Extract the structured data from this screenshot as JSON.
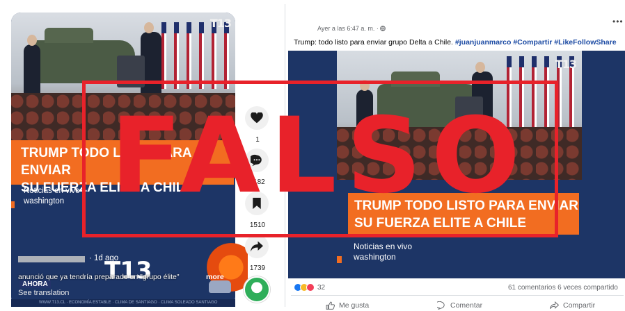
{
  "left_post": {
    "logo": "T13",
    "headline_line1": "TRUMP TODO LISTO PARA ENVIAR",
    "headline_line2": "SU FUERZA ELITE A CHILE",
    "subtitle_line1": "Noticias en vivo",
    "subtitle_line2": "washington",
    "time_ago": "· 1d ago",
    "caption": "anunció que ya tendría preparado un \"grupo élite\"",
    "more_label": "more",
    "ahora_tag": "AHORA",
    "see_translation": "See translation",
    "ticker": "WWW.T13.CL · ECONOMÍA ESTABLE · CLIMA DE SANTIAGO · CLIMA SOLEADO SANTIAGO",
    "watermark_logo": "T13"
  },
  "side_actions": {
    "like": {
      "icon": "heart-icon",
      "count": "1"
    },
    "comment": {
      "icon": "comment-icon",
      "count": "1182"
    },
    "save": {
      "icon": "bookmark-icon",
      "count": "1510"
    },
    "share": {
      "icon": "share-arrow-icon",
      "count": "1739"
    }
  },
  "fb_post": {
    "timestamp": "Ayer a las 6:47 a. m. ·",
    "text": "Trump: todo listo para enviar grupo Delta a Chile.",
    "hashtags": "#juanjuanmarco #Compartir #LikeFollowShare",
    "logo": "T13",
    "headline_line1": "TRUMP TODO LISTO PARA ENVIAR",
    "headline_line2": "SU FUERZA ELITE A CHILE",
    "subtitle_line1": "Noticias en vivo",
    "subtitle_line2": "washington",
    "reaction_count": "32",
    "stats": "61 comentarios  6 veces compartido",
    "actions": {
      "like": "Me gusta",
      "comment": "Comentar",
      "share": "Compartir"
    }
  },
  "stamp": {
    "word": "FALSO",
    "color": "#e8222a"
  },
  "colors": {
    "orange_banner": "#f26d21",
    "navy_bg": "#1d3566",
    "hashtag_blue": "#1b4aa3"
  }
}
